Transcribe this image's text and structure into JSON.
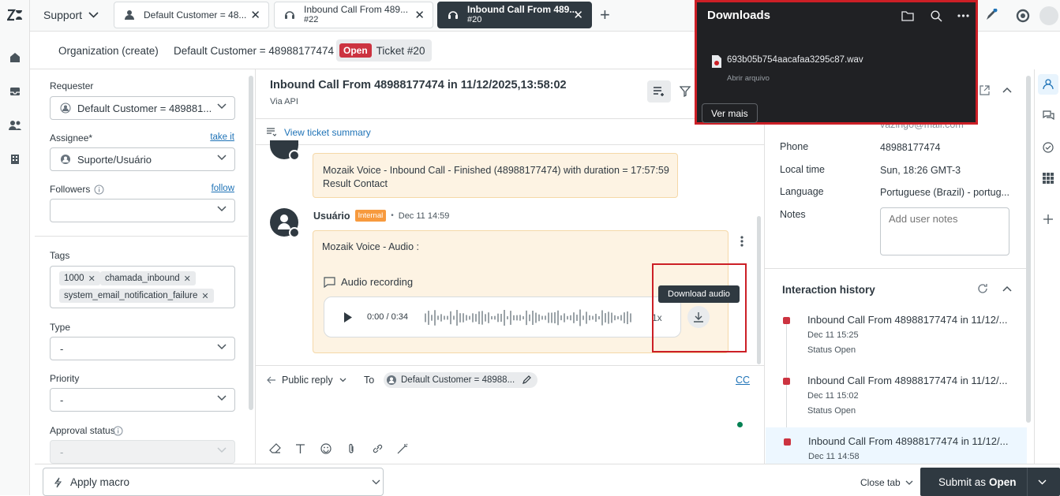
{
  "topbar": {
    "product": "Support",
    "tabs": [
      {
        "title": "Default Customer = 48...",
        "subtitle": ""
      },
      {
        "title": "Inbound Call From 489...",
        "subtitle": "#22"
      },
      {
        "title": "Inbound Call From 489...",
        "subtitle": "#20"
      }
    ],
    "close_glyph": "✕",
    "add_tab_glyph": "+"
  },
  "breadcrumb": {
    "org": "Organization (create)",
    "customer": "Default Customer = 48988177474",
    "status": "Open",
    "ticket": "Ticket #20"
  },
  "leftpanel": {
    "requester_label": "Requester",
    "requester_value": "Default Customer = 489881...",
    "assignee_label": "Assignee*",
    "take_it": "take it",
    "assignee_value": "Suporte/Usuário",
    "followers_label": "Followers",
    "follow": "follow",
    "tags_label": "Tags",
    "tags": [
      "1000",
      "chamada_inbound",
      "system_email_notification_failure"
    ],
    "type_label": "Type",
    "type_value": "-",
    "priority_label": "Priority",
    "priority_value": "-",
    "approval_label": "Approval status",
    "approval_value": "-"
  },
  "ticket": {
    "title": "Inbound Call From 48988177474 in 11/12/2025,13:58:02",
    "via": "Via API",
    "summary_link": "View ticket summary",
    "msg1_line1": "Mozaik Voice - Inbound Call - Finished (48988177474) with duration = 17:57:59",
    "msg1_line2": "Result Contact",
    "author": "Usuário",
    "internal_badge": "Internal",
    "bullet": "•",
    "msg_date": "Dec 11 14:59",
    "msg2_text": "Mozaik Voice - Audio :",
    "audio_label": "Audio recording",
    "player_time": "0:00 / 0:34",
    "speed": "1x",
    "tooltip": "Download audio"
  },
  "reply": {
    "mode": "Public reply",
    "to_label": "To",
    "recipient": "Default Customer = 48988...",
    "cc": "CC"
  },
  "user": {
    "email_partial": "vazingo@mail.com",
    "phone_label": "Phone",
    "phone": "48988177474",
    "time_label": "Local time",
    "time": "Sun, 18:26 GMT-3",
    "lang_label": "Language",
    "lang": "Portuguese (Brazil) - portug...",
    "notes_label": "Notes",
    "notes_placeholder": "Add user notes"
  },
  "history": {
    "title": "Interaction history",
    "items": [
      {
        "title": "Inbound Call From 48988177474 in 11/12/...",
        "date": "Dec 11 15:25",
        "status": "Status Open"
      },
      {
        "title": "Inbound Call From 48988177474 in 11/12/...",
        "date": "Dec 11 15:02",
        "status": "Status Open"
      },
      {
        "title": "Inbound Call From 48988177474 in 11/12/...",
        "date": "Dec 11 14:58",
        "status": ""
      }
    ]
  },
  "bottom": {
    "macro": "Apply macro",
    "close_tab": "Close tab",
    "submit_prefix": "Submit as",
    "submit_status": "Open"
  },
  "downloads": {
    "title": "Downloads",
    "file": "693b05b754aacafaa3295c87.wav",
    "sub": "Abrir arquivo",
    "more": "Ver mais"
  },
  "colors": {
    "accent": "#1f73b7",
    "dark": "#2f3941",
    "open": "#cc3340",
    "internal": "#f79a3e",
    "highlight": "#cc1f26"
  }
}
